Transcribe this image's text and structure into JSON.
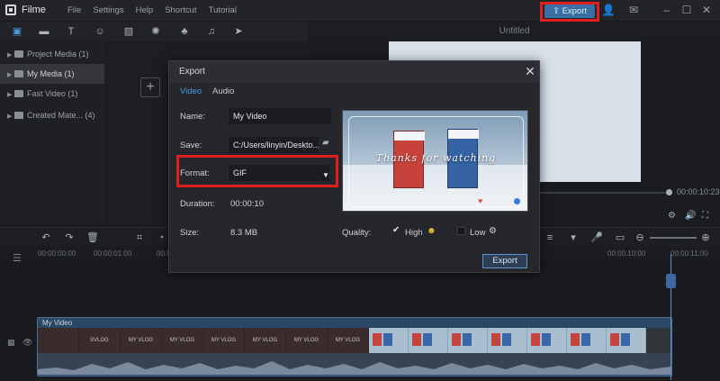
{
  "app": {
    "name": "Filme"
  },
  "menu": [
    "File",
    "Settings",
    "Help",
    "Shortcut",
    "Tutorial"
  ],
  "top_export": {
    "label": "Export"
  },
  "library": {
    "items": [
      {
        "label": "Project Media (1)"
      },
      {
        "label": "My Media (1)"
      },
      {
        "label": "Fast Video (1)"
      },
      {
        "label": "Created Mate... (4)"
      }
    ]
  },
  "preview": {
    "title": "Untitled",
    "time": "00:00:10:23"
  },
  "timeline": {
    "ticks": [
      "00:00:00:00",
      "00:00:01:00",
      "00:00:02:00",
      "00:00:10:00",
      "00:00:11:00"
    ],
    "clip_title": "My Video",
    "vlog_labels": [
      "",
      "SVLOG",
      "MY VLOG",
      "MY VLOG",
      "MY VLOG",
      "MY VLOG",
      "MY VLOG",
      "MY VLOG"
    ]
  },
  "export_dialog": {
    "title": "Export",
    "tabs": [
      "Video",
      "Audio"
    ],
    "name_label": "Name:",
    "name_value": "My Video",
    "save_label": "Save:",
    "save_value": "C:/Users/linyin/Deskto...",
    "format_label": "Format:",
    "format_value": "GIF",
    "duration_label": "Duration:",
    "duration_value": "00:00:10",
    "size_label": "Size:",
    "size_value": "8.3 MB",
    "quality_label": "Quality:",
    "quality_high": "High",
    "quality_low": "Low",
    "export_button": "Export",
    "thumb_caption": "Thanks for watching"
  },
  "colors": {
    "accent": "#4a9be0",
    "highlight": "#e0201f",
    "export_blue": "#3a6fa6"
  }
}
